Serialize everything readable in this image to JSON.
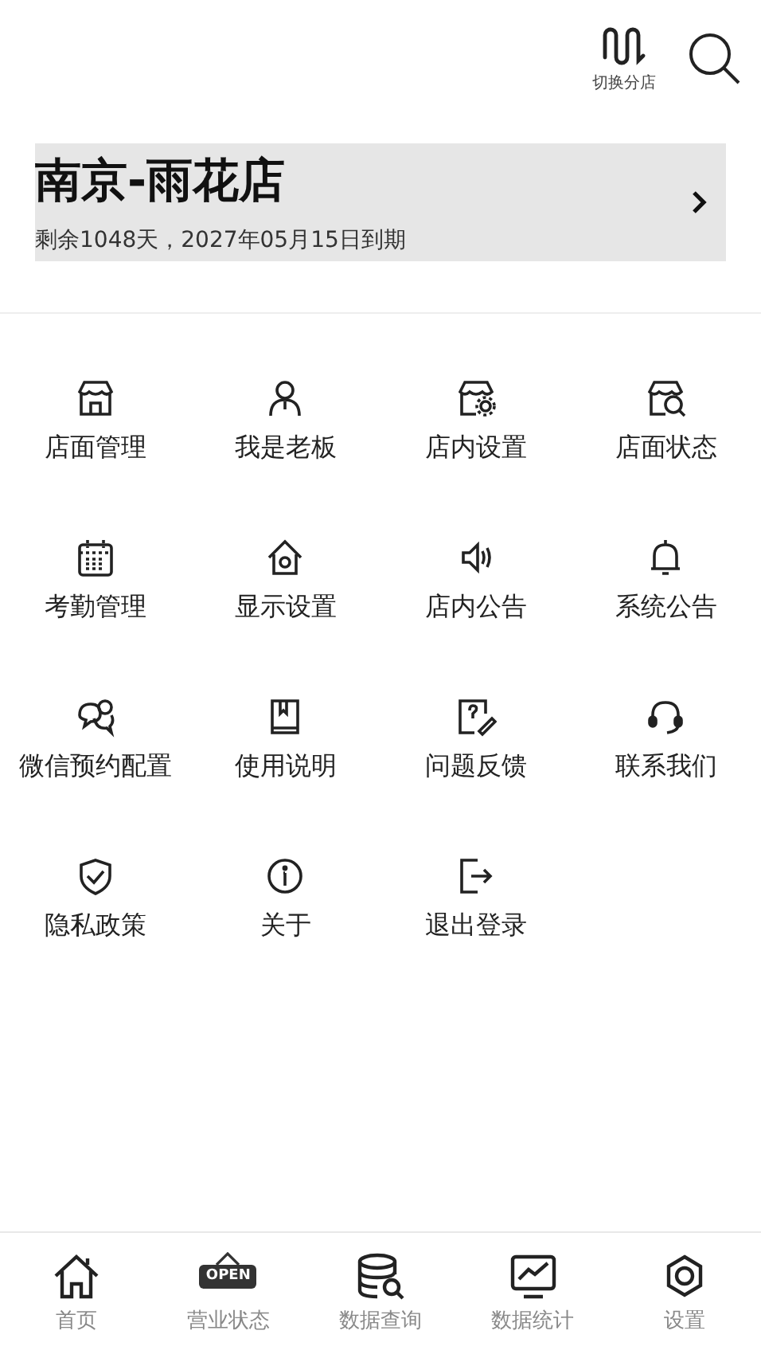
{
  "top_bar": {
    "switch_store_label": "切换分店"
  },
  "store": {
    "name": "南京-雨花店",
    "expiry": "剩余1048天，2027年05月15日到期"
  },
  "menu": [
    {
      "kind": "store",
      "label": "店面管理"
    },
    {
      "kind": "person",
      "label": "我是老板"
    },
    {
      "kind": "store-gear",
      "label": "店内设置"
    },
    {
      "kind": "store-search",
      "label": "店面状态"
    },
    {
      "kind": "calendar",
      "label": "考勤管理"
    },
    {
      "kind": "house-gear",
      "label": "显示设置"
    },
    {
      "kind": "speaker",
      "label": "店内公告"
    },
    {
      "kind": "bell",
      "label": "系统公告"
    },
    {
      "kind": "chat",
      "label": "微信预约配置"
    },
    {
      "kind": "book",
      "label": "使用说明"
    },
    {
      "kind": "question",
      "label": "问题反馈"
    },
    {
      "kind": "headset",
      "label": "联系我们"
    },
    {
      "kind": "shield",
      "label": "隐私政策"
    },
    {
      "kind": "info",
      "label": "关于"
    },
    {
      "kind": "exit",
      "label": "退出登录"
    }
  ],
  "bottom_nav": [
    {
      "kind": "home",
      "label": "首页"
    },
    {
      "kind": "open-sign",
      "label": "营业状态",
      "sign_text": "OPEN"
    },
    {
      "kind": "database",
      "label": "数据查询"
    },
    {
      "kind": "chart",
      "label": "数据统计"
    },
    {
      "kind": "gear",
      "label": "设置"
    }
  ]
}
